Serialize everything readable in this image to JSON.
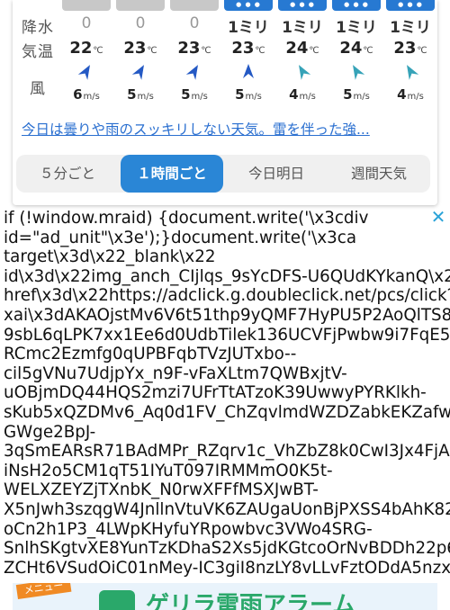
{
  "weather": {
    "row_labels": {
      "precip": "降水",
      "temp": "気温",
      "wind": "風"
    },
    "columns": [
      {
        "precip": "0",
        "temp": "22",
        "wind": "6",
        "rain_band": false,
        "arrow_color": "#2459c4",
        "arrow_dir": "north-east"
      },
      {
        "precip": "0",
        "temp": "23",
        "wind": "5",
        "rain_band": false,
        "arrow_color": "#2459c4",
        "arrow_dir": "north-east"
      },
      {
        "precip": "0",
        "temp": "23",
        "wind": "5",
        "rain_band": false,
        "arrow_color": "#2459c4",
        "arrow_dir": "north-east"
      },
      {
        "precip": "1ミリ",
        "temp": "23",
        "wind": "5",
        "rain_band": true,
        "arrow_color": "#2459c4",
        "arrow_dir": "north"
      },
      {
        "precip": "1ミリ",
        "temp": "24",
        "wind": "4",
        "rain_band": true,
        "arrow_color": "#36a3b8",
        "arrow_dir": "north-west"
      },
      {
        "precip": "1ミリ",
        "temp": "24",
        "wind": "5",
        "rain_band": true,
        "arrow_color": "#36a3b8",
        "arrow_dir": "north-west"
      },
      {
        "precip": "1ミリ",
        "temp": "23",
        "wind": "4",
        "rain_band": true,
        "arrow_color": "#36a3b8",
        "arrow_dir": "north-west"
      }
    ],
    "temp_unit": "℃",
    "wind_unit": "m/s",
    "summary_link": "今日は曇りや雨のスッキリしない天気。雷を伴った強...",
    "tabs": [
      "５分ごと",
      "１時間ごと",
      "今日明日",
      "週間天気"
    ],
    "active_tab": "１時間ごと"
  },
  "ad": {
    "close_icon": "✕",
    "code_lines": [
      "if (!window.mraid) {document.write('\\x3cdiv",
      "id=\"ad_unit\"\\x3e');}document.write('\\x3ca",
      "target\\x3d\\x22_blank\\x22",
      "id\\x3d\\x22img_anch_CIjlqs_9sYcDFS-U6QUdKYkanQ\\x22",
      "href\\x3d\\x22https://adclick.g.doubleclick.net/pcs/click?",
      "xai\\x3dAKAOjstMv6V6t51thp9yQMF7HyPU5P2AoQlTS8Bk",
      "9sbL6qLPK7xx1Ee6d0UdbTilek136UCVFjPwbw9i7FqE5hjC",
      "RCmc2Ezmfg0qUPBFqbTVzJUTxbo--",
      "cil5gVNu7UdjpYx_n9F-vFaXLtm7QWBxjtV-",
      "uOBjmDQ44HQS2mzi7UFrTtATzoK39UwwyPYRKlkh-",
      "sKub5xQZDMv6_Aq0d1FV_ChZqvlmdWZDZabkEKZafwQU",
      "GWge2BpJ-",
      "3qSmEARsR71BAdMPr_RZqrv1c_VhZbZ8k0CwI3Jx4FjAZ2",
      "iNsH2o5CM1qT51IYuT097IRMMmO0K5t-",
      "WELXZEYZjTXnbK_N0rwXFFfMSXJwBT-",
      "X5nJwh3szqgW4JnllnVtuVK6ZAUgaUonBjPXSS4bAhK824",
      "oCn2h1P3_4LWpKHyfuYRpowbvc3VWo4SRG-",
      "SnlhSKgtvXE8YunTzKDhaS2Xs5jdKGtcoOrNvBDDh22p6J2",
      "ZCHt6VSudOiC01nMey-IC3giI8nzLY8vLLvFztODdA5nzxWl"
    ]
  },
  "banner": {
    "ribbon": "メニュー",
    "title": "ゲリラ雷雨アラーム"
  }
}
